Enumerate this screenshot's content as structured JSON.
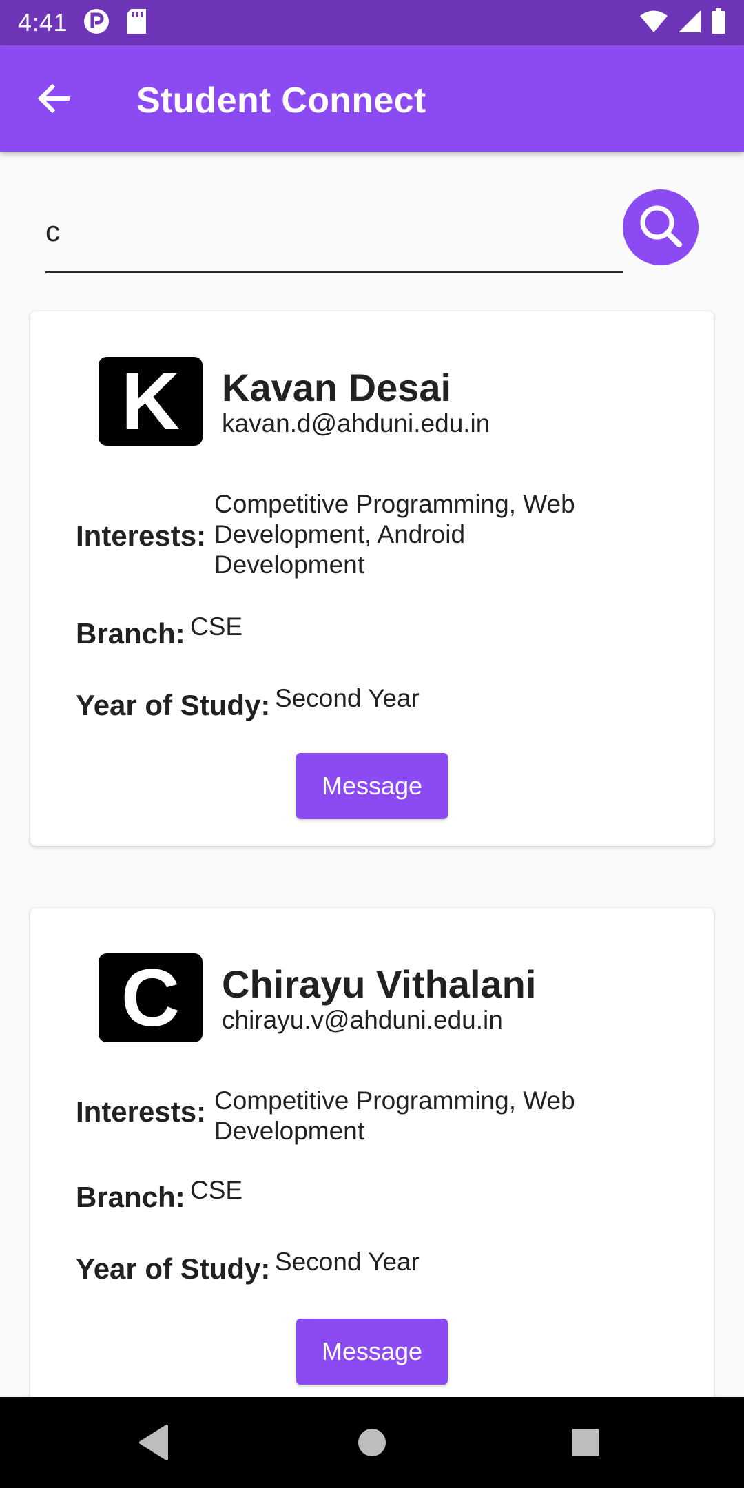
{
  "status_bar": {
    "time": "4:41"
  },
  "app_bar": {
    "title": "Student Connect"
  },
  "search": {
    "value": "c",
    "placeholder": ""
  },
  "students": [
    {
      "initial": "K",
      "name": "Kavan Desai",
      "email": "kavan.d@ahduni.edu.in",
      "interests_label": "Interests:",
      "interests_lines": [
        "Competitive Programming, Web",
        "Development, Android",
        "Development"
      ],
      "branch_label": "Branch:",
      "branch": "CSE",
      "year_label": "Year of Study:",
      "year": "Second Year",
      "button_label": "Message"
    },
    {
      "initial": "C",
      "name": "Chirayu Vithalani",
      "email": "chirayu.v@ahduni.edu.in",
      "interests_label": "Interests:",
      "interests_lines": [
        "Competitive Programming, Web",
        "Development"
      ],
      "branch_label": "Branch:",
      "branch": "CSE",
      "year_label": "Year of Study:",
      "year": "Second Year",
      "button_label": "Message"
    }
  ],
  "colors": {
    "status_bar": "#6e35b8",
    "primary": "#8c4bf2",
    "background": "#fafafa"
  },
  "icons": {
    "back": "arrow-back-icon",
    "search": "search-icon",
    "nav_back": "triangle-back-icon",
    "nav_home": "circle-home-icon",
    "nav_recents": "square-recents-icon"
  }
}
